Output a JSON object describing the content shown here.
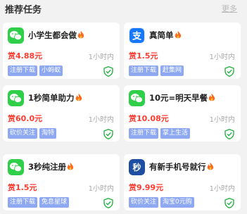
{
  "header": {
    "title": "推荐任务",
    "more": "更多"
  },
  "tasks": [
    {
      "name": "小学生都会做",
      "reward": "赏4.88元",
      "time": "1小时内",
      "tags": [
        "注册下载",
        "小蚂蚁"
      ],
      "icon": "wechat-icon"
    },
    {
      "name": "真简单",
      "reward": "赏1.5元",
      "time": "1小时内",
      "tags": [
        "注册下载",
        "赶集网"
      ],
      "icon": "alipay-icon"
    },
    {
      "name": "1秒简单助力",
      "reward": "赏60.0元",
      "time": "1小时内",
      "tags": [
        "砍价关注",
        "淘特"
      ],
      "icon": "wechat-icon"
    },
    {
      "name": "10元=明天早餐",
      "reward": "赏10.08元",
      "time": "1小时内",
      "tags": [
        "注册下载",
        "掌上生活"
      ],
      "icon": "wechat-icon"
    },
    {
      "name": "3秒纯注册",
      "reward": "赏1.5元",
      "time": "1小时内",
      "tags": [
        "注册下载",
        "免息星球"
      ],
      "icon": "wechat-icon"
    },
    {
      "name": "有新手机号就行",
      "reward": "赏9.99元",
      "time": "1小时内",
      "tags": [
        "砍价关注",
        "淘宝0元购"
      ],
      "icon": "miao-icon",
      "icon_char": "秒"
    }
  ],
  "colors": {
    "reward": "#ff3b30",
    "tag_bg": "#8ea8f2",
    "shield": "#2fb24a",
    "wechat": "#2fcf4a",
    "fire": "#ff6a1a"
  }
}
